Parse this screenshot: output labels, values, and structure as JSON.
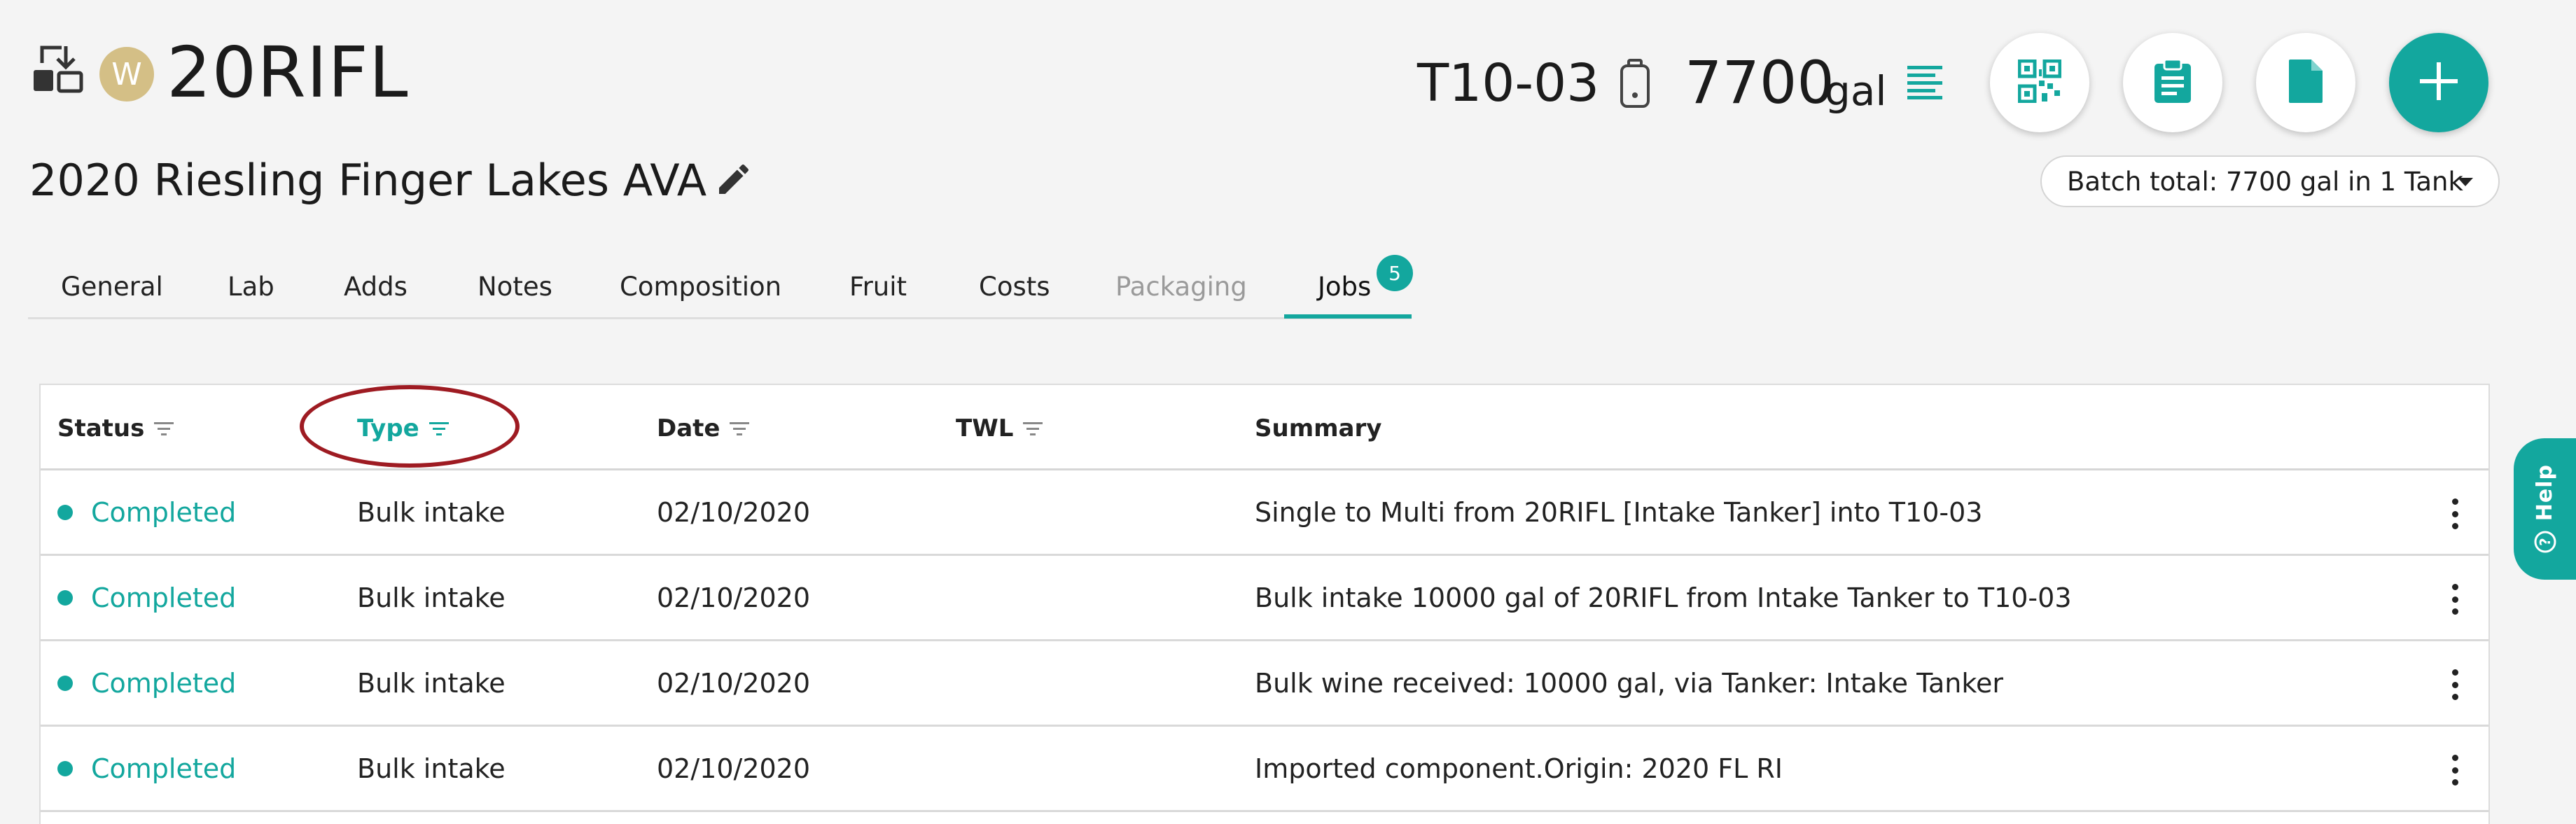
{
  "header": {
    "avatar_letter": "W",
    "batch_code": "20RIFL",
    "wine_title": "2020 Riesling Finger Lakes AVA",
    "tank_code": "T10-03",
    "volume_value": "7700",
    "volume_unit": "gal",
    "batch_total": "Batch total: 7700 gal in 1 Tank"
  },
  "tabs": [
    {
      "label": "General"
    },
    {
      "label": "Lab"
    },
    {
      "label": "Adds"
    },
    {
      "label": "Notes"
    },
    {
      "label": "Composition"
    },
    {
      "label": "Fruit"
    },
    {
      "label": "Costs"
    },
    {
      "label": "Packaging"
    },
    {
      "label": "Jobs"
    }
  ],
  "jobs_badge": "5",
  "table": {
    "columns": [
      {
        "label": "Status"
      },
      {
        "label": "Type"
      },
      {
        "label": "Date"
      },
      {
        "label": "TWL"
      },
      {
        "label": "Summary"
      }
    ],
    "rows": [
      {
        "status": "Completed",
        "type": "Bulk intake",
        "date": "02/10/2020",
        "twl": "",
        "summary": "Single to Multi from 20RIFL [Intake Tanker] into T10-03"
      },
      {
        "status": "Completed",
        "type": "Bulk intake",
        "date": "02/10/2020",
        "twl": "",
        "summary": "Bulk intake 10000 gal of 20RIFL from Intake Tanker to T10-03"
      },
      {
        "status": "Completed",
        "type": "Bulk intake",
        "date": "02/10/2020",
        "twl": "",
        "summary": "Bulk wine received: 10000 gal, via Tanker: Intake Tanker"
      },
      {
        "status": "Completed",
        "type": "Bulk intake",
        "date": "02/10/2020",
        "twl": "",
        "summary": "Imported component.Origin: 2020 FL RI"
      }
    ]
  },
  "help_label": "Help",
  "colors": {
    "accent": "#13a79e",
    "avatar": "#d4bf86",
    "annotation": "#9e1b22"
  },
  "icons": {
    "header_left": "batch-transfer-icon",
    "edit": "pencil-icon",
    "tank": "tank-icon",
    "details": "text-lines-icon",
    "qr": "qr-code-icon",
    "clipboard": "clipboard-icon",
    "document": "document-icon",
    "add": "plus-icon",
    "filter": "filter-icon",
    "menu": "kebab-menu-icon",
    "help": "help-circle-icon"
  }
}
